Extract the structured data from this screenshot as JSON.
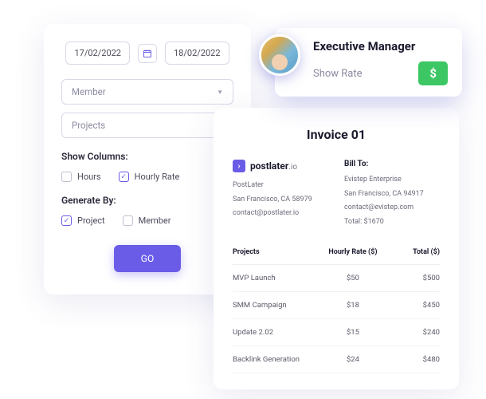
{
  "filter": {
    "date_from": "17/02/2022",
    "date_to": "18/02/2022",
    "member_placeholder": "Member",
    "projects_placeholder": "Projects",
    "show_columns_label": "Show Columns:",
    "col_hours": "Hours",
    "col_rate": "Hourly Rate",
    "generate_by_label": "Generate By:",
    "by_project": "Project",
    "by_member": "Member",
    "go_label": "GO"
  },
  "invoice": {
    "title": "Invoice 01",
    "brand_name": "postlater",
    "brand_suffix": ".io",
    "from_name": "PostLater",
    "from_addr": "San Francisco, CA 58979",
    "from_email": "contact@postlater.io",
    "bill_to_label": "Bill To:",
    "to_name": "Evistep Enterprise",
    "to_addr": "San Francisco, CA 94917",
    "to_email": "contact@evistep.com",
    "total_label": "Total: $1670",
    "head_projects": "Projects",
    "head_rate": "Hourly Rate ($)",
    "head_total": "Total ($)",
    "rows": [
      {
        "p": "MVP Launch",
        "r": "$50",
        "t": "$500"
      },
      {
        "p": "SMM Campaign",
        "r": "$18",
        "t": "$450"
      },
      {
        "p": "Update 2.02",
        "r": "$15",
        "t": "$240"
      },
      {
        "p": "Backlink Generation",
        "r": "$24",
        "t": "$480"
      }
    ]
  },
  "manager": {
    "title": "Executive Manager",
    "rate_label": "Show Rate",
    "rate_symbol": "$"
  }
}
